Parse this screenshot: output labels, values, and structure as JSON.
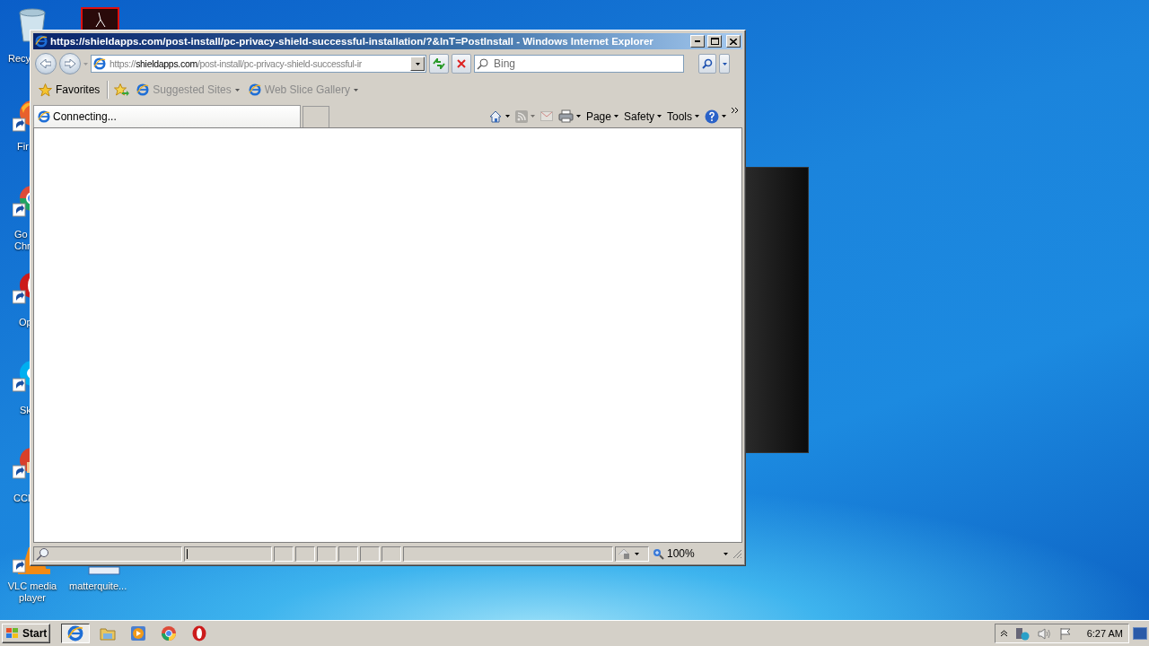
{
  "desktop_icons": [
    {
      "kind": "recycle",
      "label": "Recy"
    },
    {
      "kind": "pdf"
    },
    {
      "kind": "firefox",
      "label": "Fir"
    },
    {
      "kind": "chrome",
      "label": "Go Chr"
    },
    {
      "kind": "opera",
      "label": "Op"
    },
    {
      "kind": "skype",
      "label": "Sk"
    },
    {
      "kind": "ccleaner",
      "label": "CCl"
    },
    {
      "kind": "vlc",
      "label": "VLC media player"
    },
    {
      "kind": "file",
      "label": "matterquite..."
    }
  ],
  "window": {
    "title": "https://shieldapps.com/post-install/pc-privacy-shield-successful-installation/?&lnT=PostInstall - Windows Internet Explorer"
  },
  "address_bar": {
    "scheme": "https://",
    "host": "shieldapps.com",
    "path": "/post-install/pc-privacy-shield-successful-ir"
  },
  "search": {
    "placeholder": "Bing"
  },
  "favorites_bar": {
    "favorites": "Favorites",
    "links": [
      {
        "label": "Suggested Sites",
        "disabled": true
      },
      {
        "label": "Web Slice Gallery",
        "disabled": true
      }
    ]
  },
  "tabs": [
    {
      "label": "Connecting...",
      "selected": true
    }
  ],
  "command_bar": {
    "tools": [
      {
        "kind": "home",
        "disabled": false
      },
      {
        "kind": "feeds",
        "disabled": true
      },
      {
        "kind": "mail",
        "disabled": true
      },
      {
        "kind": "print",
        "disabled": false
      }
    ],
    "menus": [
      {
        "label": "Page"
      },
      {
        "label": "Safety"
      },
      {
        "label": "Tools"
      }
    ]
  },
  "status_bar": {
    "zoom": "100%"
  },
  "taskbar": {
    "start": "Start",
    "pinned": [
      {
        "kind": "ie",
        "selected": true
      },
      {
        "kind": "explorer",
        "selected": false
      },
      {
        "kind": "media",
        "selected": false
      },
      {
        "kind": "chrome",
        "selected": false
      },
      {
        "kind": "opera",
        "selected": false
      }
    ],
    "clock": "6:27 AM"
  }
}
